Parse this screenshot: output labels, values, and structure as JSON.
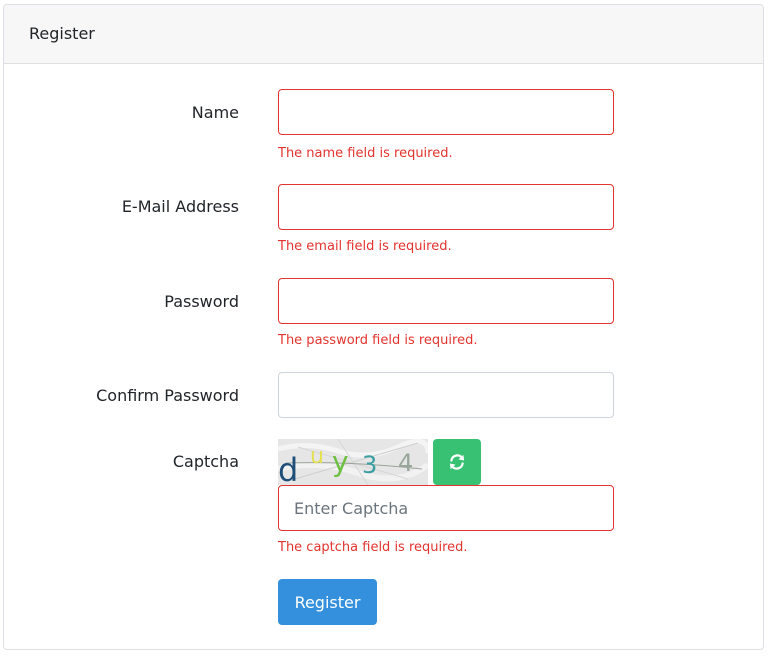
{
  "card": {
    "title": "Register"
  },
  "form": {
    "name": {
      "label": "Name",
      "value": "",
      "error": "The name field is required."
    },
    "email": {
      "label": "E-Mail Address",
      "value": "",
      "error": "The email field is required."
    },
    "password": {
      "label": "Password",
      "value": "",
      "error": "The password field is required."
    },
    "confirm_password": {
      "label": "Confirm Password",
      "value": ""
    },
    "captcha": {
      "label": "Captcha",
      "image_text": "duy34",
      "refresh_icon": "refresh-icon",
      "placeholder": "Enter Captcha",
      "value": "",
      "error": "The captcha field is required."
    },
    "submit_label": "Register"
  },
  "colors": {
    "error": "#e3342f",
    "primary": "#3490dc",
    "success": "#38c172"
  }
}
